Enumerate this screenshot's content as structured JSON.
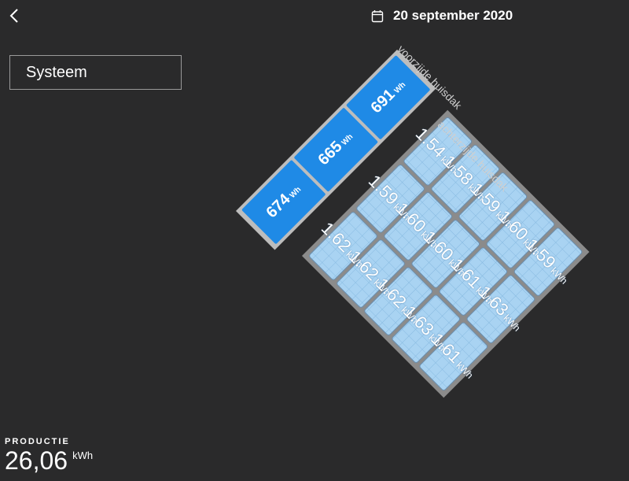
{
  "header": {
    "back_icon": "chevron-left-icon",
    "calendar_icon": "calendar-icon",
    "date": "20 september 2020"
  },
  "selector": {
    "value": "Systeem"
  },
  "roof": {
    "front": {
      "label": "voorzijde huisdak",
      "unit": "Wh",
      "color": "#1f8ae6",
      "panels": [
        "674",
        "665",
        "691"
      ]
    },
    "back": {
      "label": "achterzijde huisdak",
      "unit": "kWh",
      "color": "#a9d3f2",
      "panels": [
        "1.62",
        "1.62",
        "1.62",
        "1.63",
        "1.61",
        "1.59",
        "1.60",
        "1.60",
        "1.61",
        "1.63",
        "1.54",
        "1.58",
        "1.59",
        "1.60",
        "1.59"
      ]
    }
  },
  "production": {
    "label": "PRODUCTIE",
    "value": "26,06",
    "unit": "kWh"
  }
}
